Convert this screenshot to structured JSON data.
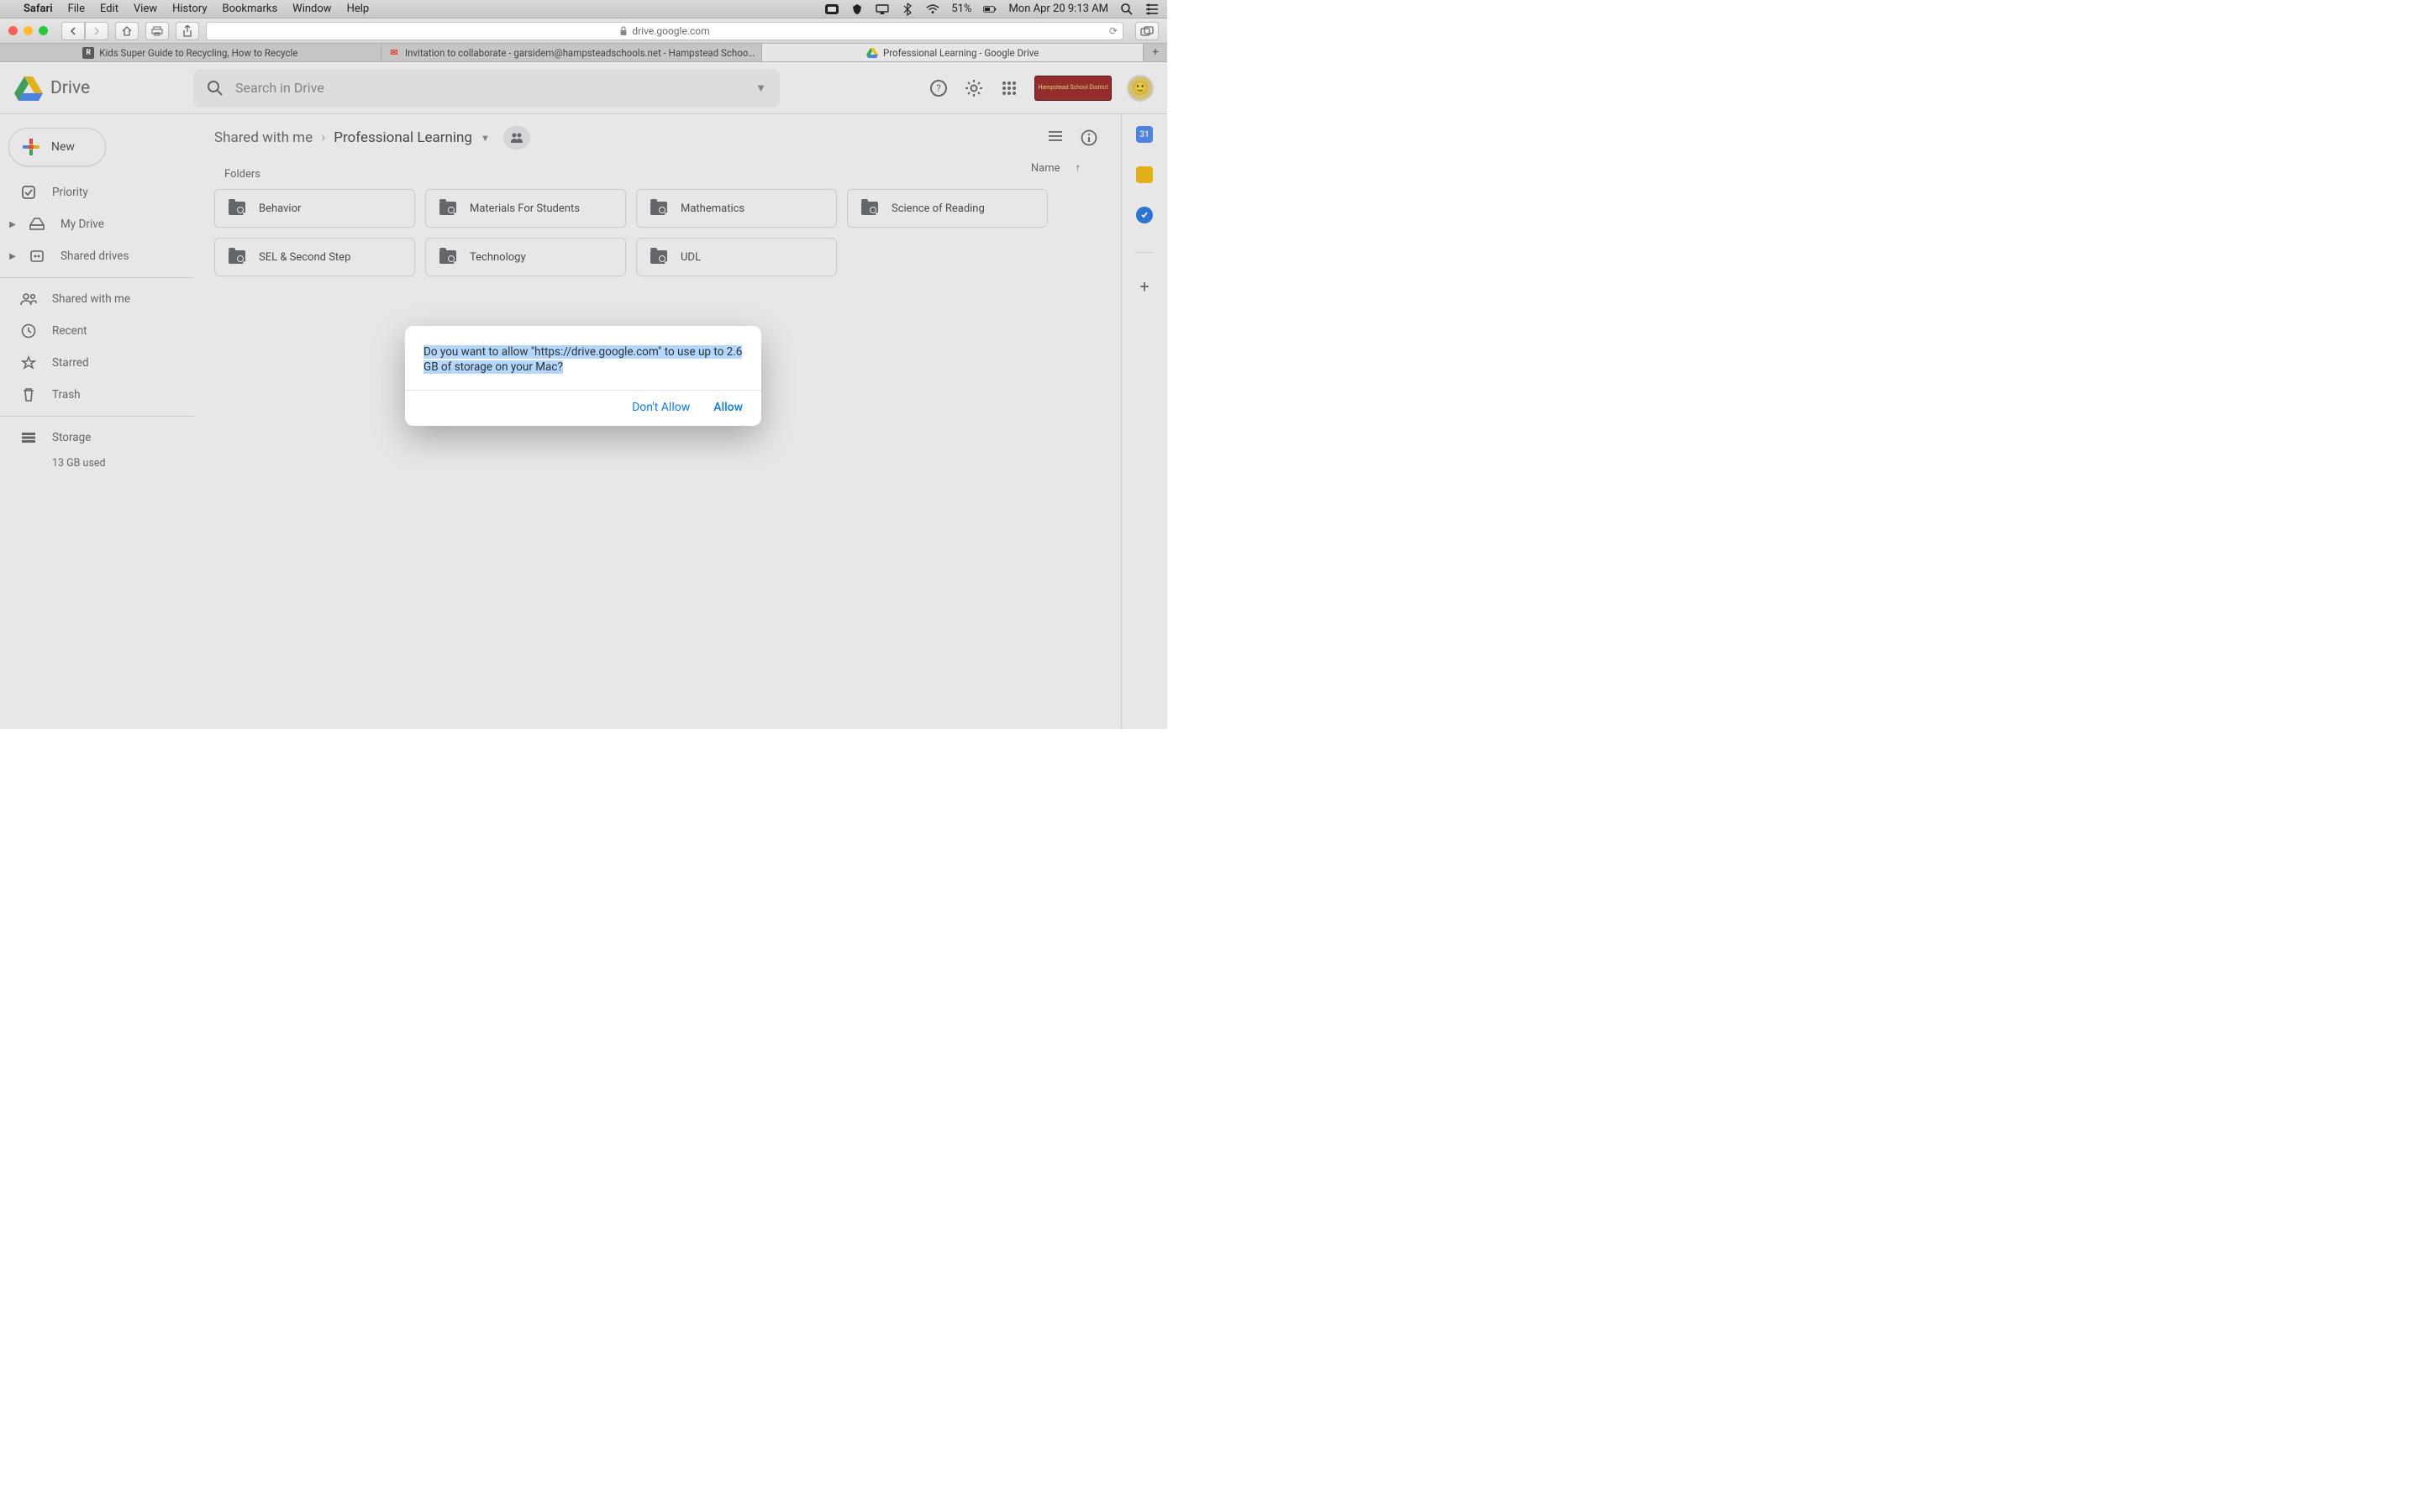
{
  "menubar": {
    "app": "Safari",
    "items": [
      "File",
      "Edit",
      "View",
      "History",
      "Bookmarks",
      "Window",
      "Help"
    ],
    "battery_pct": "51%",
    "datetime": "Mon Apr 20  9:13 AM"
  },
  "safari": {
    "url_host": "drive.google.com",
    "tabs": [
      {
        "label": "Kids Super Guide to Recycling, How to Recycle",
        "favicon": "R",
        "active": false
      },
      {
        "label": "Invitation to collaborate - garsidem@hampsteadschools.net - Hampstead Schoo…",
        "favicon": "M",
        "active": false
      },
      {
        "label": "Professional Learning - Google Drive",
        "favicon": "△",
        "active": true
      }
    ]
  },
  "drive": {
    "app_name": "Drive",
    "search_placeholder": "Search in Drive",
    "new_label": "New",
    "nav": {
      "priority": "Priority",
      "my_drive": "My Drive",
      "shared_drives": "Shared drives",
      "shared_with_me": "Shared with me",
      "recent": "Recent",
      "starred": "Starred",
      "trash": "Trash",
      "storage": "Storage",
      "storage_used": "13 GB used"
    },
    "breadcrumb": {
      "root": "Shared with me",
      "current": "Professional Learning"
    },
    "section_folders": "Folders",
    "sort_label": "Name",
    "folders": [
      "Behavior",
      "Materials For Students",
      "Mathematics",
      "Science of Reading",
      "SEL & Second Step",
      "Technology",
      "UDL"
    ],
    "brand_text": "Hampstead School District"
  },
  "dialog": {
    "message": "Do you want to allow \"https://drive.google.com\" to use up to 2.6 GB of storage on your Mac?",
    "dont_allow": "Don't Allow",
    "allow": "Allow"
  }
}
